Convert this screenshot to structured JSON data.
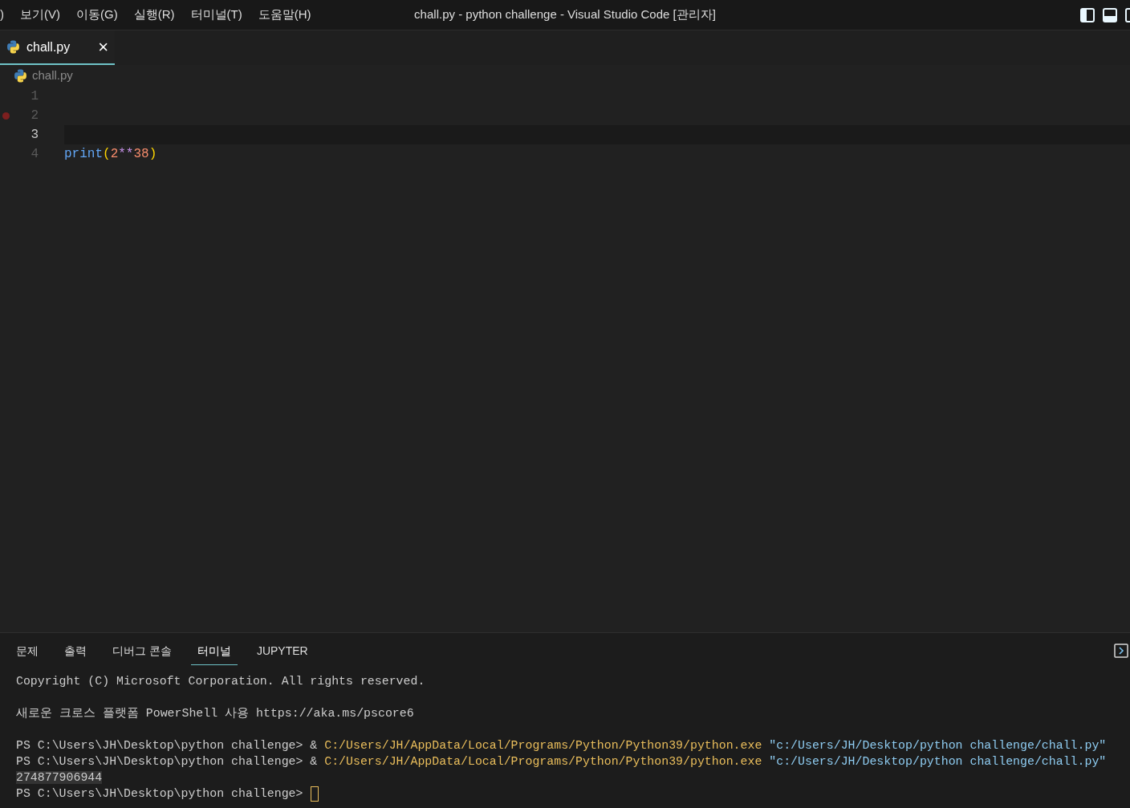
{
  "menu": [
    {
      "label": ")"
    },
    {
      "label": "보기(V)"
    },
    {
      "label": "이동(G)"
    },
    {
      "label": "실행(R)"
    },
    {
      "label": "터미널(T)"
    },
    {
      "label": "도움말(H)"
    }
  ],
  "window": {
    "title": "chall.py - python challenge - Visual Studio Code [관리자]"
  },
  "tabs": [
    {
      "label": "chall.py",
      "selected": true,
      "close": "×"
    }
  ],
  "breadcrumb": "chall.py",
  "editor": {
    "lines": [
      {
        "number": "1",
        "breakpoint": false,
        "current": false
      },
      {
        "number": "2",
        "breakpoint": true,
        "current": false
      },
      {
        "number": "3",
        "breakpoint": false,
        "current": true
      },
      {
        "number": "4",
        "breakpoint": false,
        "current": false,
        "tokens": [
          {
            "kind": "function",
            "text": "print"
          },
          {
            "kind": "bracket",
            "text": "("
          },
          {
            "kind": "number",
            "text": "2"
          },
          {
            "kind": "operator",
            "text": "**"
          },
          {
            "kind": "number",
            "text": "38"
          },
          {
            "kind": "bracket",
            "text": ")"
          }
        ]
      }
    ]
  },
  "panel": {
    "tabs": [
      {
        "label": "문제",
        "selected": false
      },
      {
        "label": "출력",
        "selected": false
      },
      {
        "label": "디버그 콘솔",
        "selected": false
      },
      {
        "label": "터미널",
        "selected": true
      },
      {
        "label": "JUPYTER",
        "selected": false
      }
    ],
    "terminal": {
      "lines": [
        {
          "kind": "text",
          "segments": [
            {
              "kind": "plain",
              "text": "Copyright (C) Microsoft Corporation. All rights reserved."
            }
          ]
        },
        {
          "kind": "blank"
        },
        {
          "kind": "text",
          "segments": [
            {
              "kind": "plain",
              "text": "새로운 크로스 플랫폼 PowerShell 사용 https://aka.ms/pscore6"
            }
          ]
        },
        {
          "kind": "blank"
        },
        {
          "kind": "text",
          "segments": [
            {
              "kind": "plain",
              "text": "PS C:\\Users\\JH\\Desktop\\python challenge> & "
            },
            {
              "kind": "path",
              "text": "C:/Users/JH/AppData/Local/Programs/Python/Python39/python.exe"
            },
            {
              "kind": "string",
              "text": " \"c:/Users/JH/Desktop/python challenge/chall.py\""
            }
          ]
        },
        {
          "kind": "text",
          "segments": [
            {
              "kind": "plain",
              "text": "PS C:\\Users\\JH\\Desktop\\python challenge> & "
            },
            {
              "kind": "path",
              "text": "C:/Users/JH/AppData/Local/Programs/Python/Python39/python.exe"
            },
            {
              "kind": "string",
              "text": " \"c:/Users/JH/Desktop/python challenge/chall.py\""
            }
          ]
        },
        {
          "kind": "text",
          "segments": [
            {
              "kind": "highlight",
              "text": "274877906944"
            }
          ]
        },
        {
          "kind": "text",
          "cursor": true,
          "segments": [
            {
              "kind": "plain",
              "text": "PS C:\\Users\\JH\\Desktop\\python challenge> "
            }
          ]
        }
      ]
    }
  }
}
